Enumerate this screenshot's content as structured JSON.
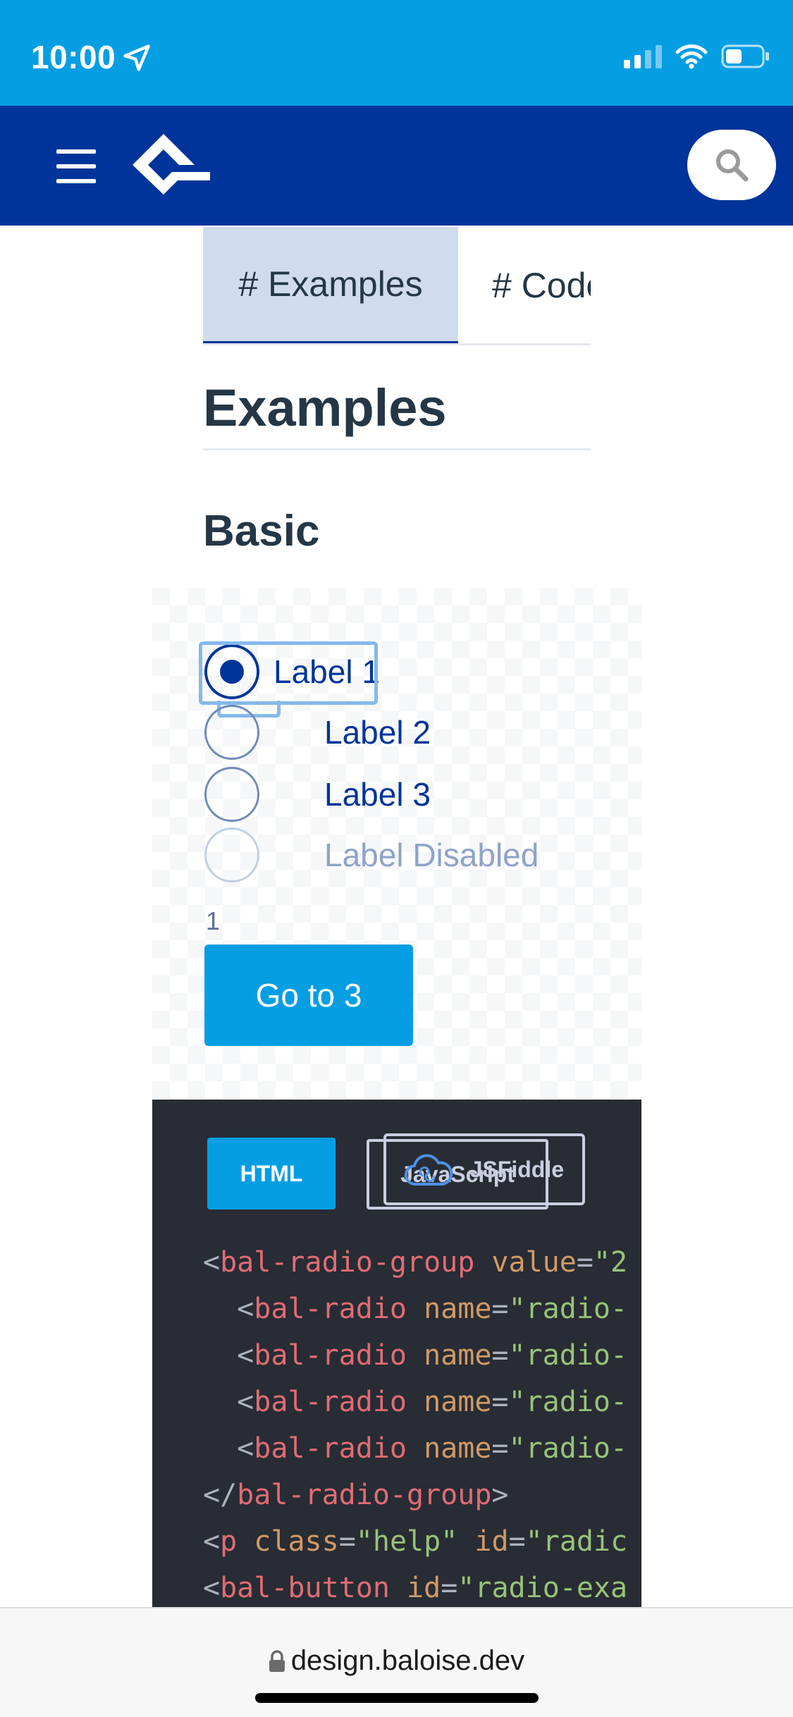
{
  "status_bar": {
    "time": "10:00",
    "icons": [
      "location-arrow-icon",
      "signal-icon",
      "wifi-icon",
      "battery-icon"
    ]
  },
  "header": {
    "menu_icon": "hamburger-icon",
    "logo_icon": "baloise-logo-icon",
    "search_icon": "search-icon",
    "colors": {
      "background": "#00349a",
      "status": "#069ee3"
    }
  },
  "tabs": [
    {
      "label": "# Examples",
      "active": true
    },
    {
      "label": "# Code",
      "active": false
    }
  ],
  "content": {
    "title": "Examples",
    "subtitle": "Basic"
  },
  "example": {
    "radios": [
      {
        "label": "Label 1",
        "checked": true,
        "disabled": false
      },
      {
        "label": "Label 2",
        "checked": false,
        "disabled": false
      },
      {
        "label": "Label 3",
        "checked": false,
        "disabled": false
      },
      {
        "label": "Label Disabled",
        "checked": false,
        "disabled": true
      }
    ],
    "help_text": "1",
    "button_label": "Go to 3"
  },
  "code": {
    "html_tab": "HTML",
    "js_tab": "JavaScript",
    "fiddle_tab": "JSFiddle",
    "lines": [
      [
        {
          "c": "b",
          "t": "<"
        },
        {
          "c": "t",
          "t": "bal-radio-group"
        },
        {
          "c": "b",
          "t": " "
        },
        {
          "c": "a",
          "t": "value"
        },
        {
          "c": "b",
          "t": "="
        },
        {
          "c": "s",
          "t": "\"2"
        }
      ],
      [
        {
          "c": "b",
          "t": "  <"
        },
        {
          "c": "t",
          "t": "bal-radio"
        },
        {
          "c": "b",
          "t": " "
        },
        {
          "c": "a",
          "t": "name"
        },
        {
          "c": "b",
          "t": "="
        },
        {
          "c": "s",
          "t": "\"radio-"
        }
      ],
      [
        {
          "c": "b",
          "t": "  <"
        },
        {
          "c": "t",
          "t": "bal-radio"
        },
        {
          "c": "b",
          "t": " "
        },
        {
          "c": "a",
          "t": "name"
        },
        {
          "c": "b",
          "t": "="
        },
        {
          "c": "s",
          "t": "\"radio-"
        }
      ],
      [
        {
          "c": "b",
          "t": "  <"
        },
        {
          "c": "t",
          "t": "bal-radio"
        },
        {
          "c": "b",
          "t": " "
        },
        {
          "c": "a",
          "t": "name"
        },
        {
          "c": "b",
          "t": "="
        },
        {
          "c": "s",
          "t": "\"radio-"
        }
      ],
      [
        {
          "c": "b",
          "t": "  <"
        },
        {
          "c": "t",
          "t": "bal-radio"
        },
        {
          "c": "b",
          "t": " "
        },
        {
          "c": "a",
          "t": "name"
        },
        {
          "c": "b",
          "t": "="
        },
        {
          "c": "s",
          "t": "\"radio-"
        }
      ],
      [
        {
          "c": "b",
          "t": "</"
        },
        {
          "c": "t",
          "t": "bal-radio-group"
        },
        {
          "c": "b",
          "t": ">"
        }
      ],
      [
        {
          "c": "b",
          "t": "<"
        },
        {
          "c": "t",
          "t": "p"
        },
        {
          "c": "b",
          "t": " "
        },
        {
          "c": "a",
          "t": "class"
        },
        {
          "c": "b",
          "t": "="
        },
        {
          "c": "s",
          "t": "\"help\""
        },
        {
          "c": "b",
          "t": " "
        },
        {
          "c": "a",
          "t": "id"
        },
        {
          "c": "b",
          "t": "="
        },
        {
          "c": "s",
          "t": "\"radic"
        }
      ],
      [
        {
          "c": "b",
          "t": "<"
        },
        {
          "c": "t",
          "t": "bal-button"
        },
        {
          "c": "b",
          "t": " "
        },
        {
          "c": "a",
          "t": "id"
        },
        {
          "c": "b",
          "t": "="
        },
        {
          "c": "s",
          "t": "\"radio-exa"
        }
      ]
    ]
  },
  "browser": {
    "url": "design.baloise.dev",
    "lock_icon": "lock-icon"
  }
}
